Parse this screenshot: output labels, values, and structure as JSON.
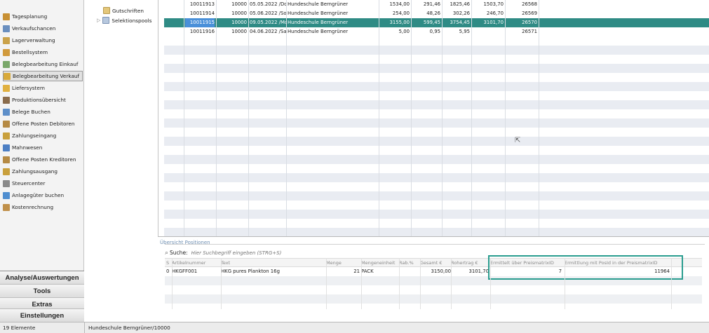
{
  "nav": {
    "items": [
      {
        "label": "Tagesplanung",
        "icon": "calendar-icon",
        "color": "#c89034"
      },
      {
        "label": "Verkaufschancen",
        "icon": "handshake-icon",
        "color": "#6a8fbf"
      },
      {
        "label": "Lagerverwaltung",
        "icon": "warehouse-icon",
        "color": "#caa24a"
      },
      {
        "label": "Bestellsystem",
        "icon": "cart-icon",
        "color": "#d19a3c"
      },
      {
        "label": "Belegbearbeitung Einkauf",
        "icon": "document-icon",
        "color": "#7aa86a"
      },
      {
        "label": "Belegbearbeitung Verkauf",
        "icon": "document-icon",
        "color": "#d8a93a"
      },
      {
        "label": "Liefersystem",
        "icon": "box-icon",
        "color": "#e0b040"
      },
      {
        "label": "Produktionsübersicht",
        "icon": "factory-icon",
        "color": "#8a6c4c"
      },
      {
        "label": "Belege Buchen",
        "icon": "book-icon",
        "color": "#5e8fc9"
      },
      {
        "label": "Offene Posten Debitoren",
        "icon": "ledger-icon",
        "color": "#b58a44"
      },
      {
        "label": "Zahlungseingang",
        "icon": "money-bag-icon",
        "color": "#c9a03c"
      },
      {
        "label": "Mahnwesen",
        "icon": "warning-letter-icon",
        "color": "#4d7fc4"
      },
      {
        "label": "Offene Posten Kreditoren",
        "icon": "ledger-icon",
        "color": "#b58a44"
      },
      {
        "label": "Zahlungsausgang",
        "icon": "money-bag-icon",
        "color": "#c9a03c"
      },
      {
        "label": "Steuercenter",
        "icon": "tax-icon",
        "color": "#8a8a8a"
      },
      {
        "label": "Anlagegüter buchen",
        "icon": "asset-icon",
        "color": "#4f8ed0"
      },
      {
        "label": "Kostenrechnung",
        "icon": "calculator-icon",
        "color": "#c0904a"
      }
    ],
    "selected": "Belegbearbeitung Verkauf",
    "sections": [
      "Analyse/Auswertungen",
      "Tools",
      "Extras",
      "Einstellungen"
    ]
  },
  "tree": {
    "items": [
      "Gutschriften",
      "Selektionspools"
    ]
  },
  "grid": {
    "rows": [
      [
        "10011913",
        "10000",
        "05.05.2022 /Do",
        "Hundeschule Berngrüner",
        "1534,00",
        "291,46",
        "1825,46",
        "1503,70",
        "26568"
      ],
      [
        "10011914",
        "10000",
        "05.06.2022 /So",
        "Hundeschule Berngrüner",
        "254,00",
        "48,26",
        "302,26",
        "246,70",
        "26569"
      ],
      [
        "10011915",
        "10000",
        "09.05.2022 /Mo",
        "Hundeschule Berngrüner",
        "3155,00",
        "599,45",
        "3754,45",
        "3101,70",
        "26570"
      ],
      [
        "10011916",
        "10000",
        "04.06.2022 /Sa",
        "Hundeschule Berngrüner",
        "5,00",
        "0,95",
        "5,95",
        "",
        "26571"
      ]
    ],
    "selected_row": 2
  },
  "positions": {
    "title": "Übersicht Positionen",
    "search_label": "Suche:",
    "search_placeholder": "Hier Suchbegriff eingeben (STRG+S)",
    "columns": [
      "S",
      "Artikelnummer",
      "Text",
      "Menge",
      "Mengeneinheit",
      "Rab.%",
      "Gesamt €",
      "Rohertrag €",
      "Ermittelt über PreismatrixID",
      "Ermittlung mit PosId in der PreismatrixID"
    ],
    "rows": [
      [
        "0",
        "HKGFF001",
        "HKG pures Plankton 16g",
        "21",
        "PACK",
        "",
        "3150,00",
        "3101,70",
        "7",
        "11964"
      ]
    ],
    "highlight_color": "#2a9d8f"
  },
  "status": {
    "count": "19 Elemente",
    "customer": "Hundeschule Berngrüner/10000"
  }
}
